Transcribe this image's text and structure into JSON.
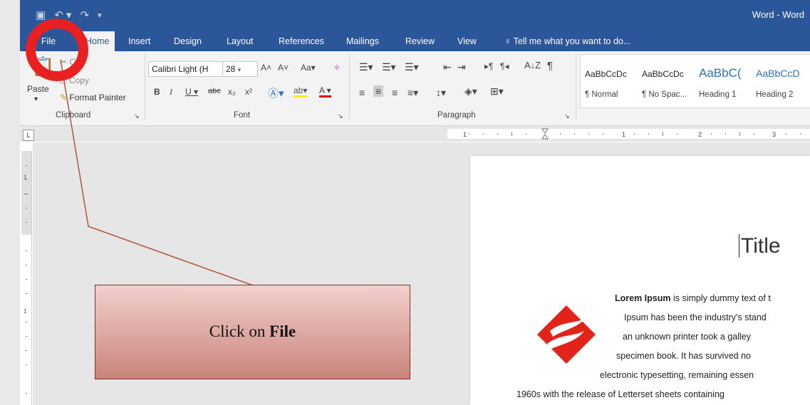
{
  "app": {
    "title": "Word - Word"
  },
  "tabs": [
    "File",
    "Home",
    "Insert",
    "Design",
    "Layout",
    "References",
    "Mailings",
    "Review",
    "View"
  ],
  "tell_me": "Tell me what you want to do...",
  "clipboard": {
    "paste": "Paste",
    "cut": "Cut",
    "copy": "Copy",
    "format_painter": "Format Painter",
    "label": "Clipboard"
  },
  "font": {
    "name": "Calibri Light (H",
    "size": "28",
    "label": "Font"
  },
  "paragraph": {
    "label": "Paragraph"
  },
  "styles": [
    {
      "preview": "AaBbCcDc",
      "name": "¶ Normal"
    },
    {
      "preview": "AaBbCcDc",
      "name": "¶ No Spac..."
    },
    {
      "preview": "AaBbC(",
      "name": "Heading 1"
    },
    {
      "preview": "AaBbCcD",
      "name": "Heading 2"
    }
  ],
  "document": {
    "title": "Title",
    "lines": [
      {
        "bold": "Lorem Ipsum",
        "text": " is simply dummy text of t"
      },
      {
        "bold": "",
        "text": "Ipsum has been the industry's stand"
      },
      {
        "bold": "",
        "text": "an unknown printer took a galley"
      },
      {
        "bold": "",
        "text": "specimen book. It has survived no"
      },
      {
        "bold": "",
        "text": "electronic typesetting, remaining essen"
      },
      {
        "bold": "",
        "text": "1960s with the release of Letterset sheets containing"
      }
    ]
  },
  "callout": {
    "prefix": "Click on ",
    "emphasis": "File"
  },
  "colors": {
    "brand": "#2b579a",
    "highlight_ring": "#e8201f",
    "logo": "#e2231a"
  }
}
